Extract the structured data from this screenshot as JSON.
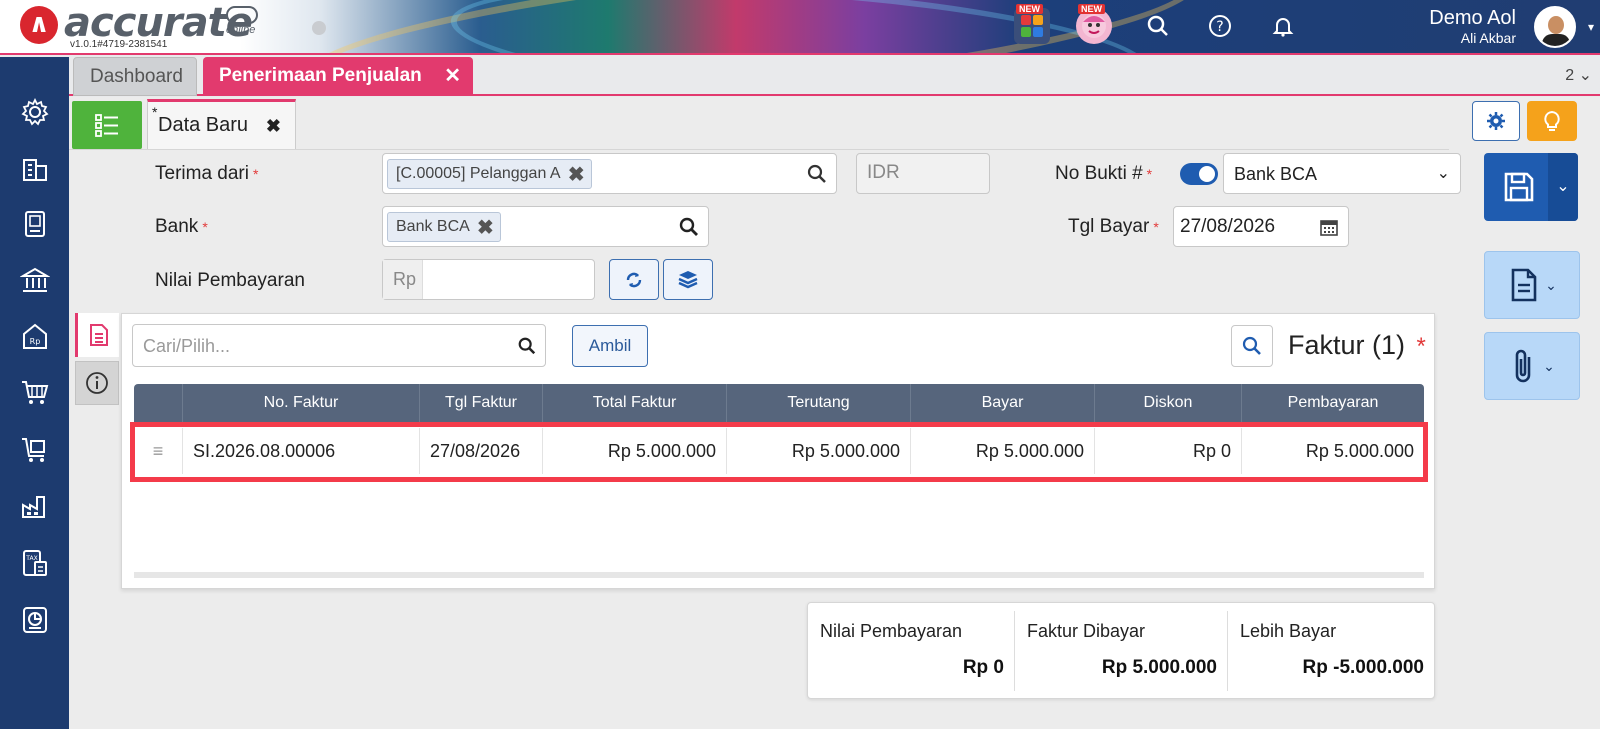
{
  "app": {
    "logo_text": "accurate",
    "logo_sub": "online",
    "version": "v1.0.1#4719-2381541",
    "new_badge_1": "NEW",
    "new_badge_2": "NEW",
    "user_name": "Demo Aol",
    "user_sub": "Ali Akbar"
  },
  "tabs": {
    "dashboard": "Dashboard",
    "active": "Penerimaan Penjualan",
    "count": "2"
  },
  "subtab": {
    "star": "*",
    "label": "Data Baru"
  },
  "form": {
    "terima_dari_label": "Terima dari",
    "terima_dari_value": "[C.00005] Pelanggan A",
    "currency": "IDR",
    "no_bukti_label": "No Bukti #",
    "no_bukti_value": "Bank BCA",
    "bank_label": "Bank",
    "bank_value": "Bank BCA",
    "tgl_bayar_label": "Tgl Bayar",
    "tgl_bayar_value": "27/08/2026",
    "nilai_label": "Nilai Pembayaran",
    "rp_prefix": "Rp",
    "required_mark": "*"
  },
  "panel": {
    "search_placeholder": "Cari/Pilih...",
    "ambil": "Ambil",
    "title": "Faktur (1)",
    "required_mark": "*",
    "columns": [
      "No. Faktur",
      "Tgl Faktur",
      "Total Faktur",
      "Terutang",
      "Bayar",
      "Diskon",
      "Pembayaran"
    ],
    "rows": [
      {
        "no_faktur": "SI.2026.08.00006",
        "tgl_faktur": "27/08/2026",
        "total_faktur": "Rp 5.000.000",
        "terutang": "Rp 5.000.000",
        "bayar": "Rp 5.000.000",
        "diskon": "Rp 0",
        "pembayaran": "Rp 5.000.000"
      }
    ]
  },
  "summary": {
    "nilai_label": "Nilai Pembayaran",
    "nilai_value": "Rp 0",
    "faktur_label": "Faktur Dibayar",
    "faktur_value": "Rp 5.000.000",
    "lebih_label": "Lebih Bayar",
    "lebih_value": "Rp -5.000.000"
  },
  "colors": {
    "accent_pink": "#e23a6e",
    "sidebar_blue": "#1d3b6f",
    "primary_blue": "#1f5cb0",
    "green": "#4fb33c",
    "orange": "#f5a21b",
    "highlight_red": "#f43b4a"
  },
  "icons": [
    "settings-icon",
    "company-icon",
    "ledger-icon",
    "bank-icon",
    "sales-tag-icon",
    "purchase-cart-icon",
    "inventory-cart-icon",
    "factory-icon",
    "tax-icon",
    "report-icon"
  ]
}
